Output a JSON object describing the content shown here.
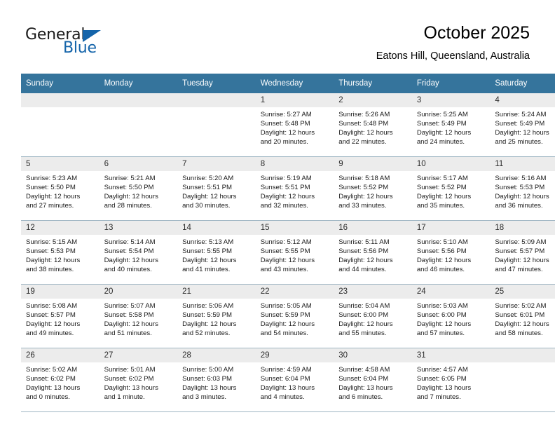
{
  "brand": {
    "name_part1": "General",
    "name_part2": "Blue",
    "logo_icon": "triangle-logo-icon",
    "accent_color": "#1464aa"
  },
  "header": {
    "month_title": "October 2025",
    "location": "Eatons Hill, Queensland, Australia"
  },
  "calendar": {
    "header_bg": "#35749c",
    "daynum_bg": "#ececec",
    "border_color": "#9fb6c4",
    "weekday_headers": [
      "Sunday",
      "Monday",
      "Tuesday",
      "Wednesday",
      "Thursday",
      "Friday",
      "Saturday"
    ],
    "labels": {
      "sunrise": "Sunrise:",
      "sunset": "Sunset:",
      "daylight": "Daylight:"
    },
    "weeks": [
      [
        {
          "day": "",
          "empty": true
        },
        {
          "day": "",
          "empty": true
        },
        {
          "day": "",
          "empty": true
        },
        {
          "day": "1",
          "sunrise": "Sunrise: 5:27 AM",
          "sunset": "Sunset: 5:48 PM",
          "daylight_line1": "Daylight: 12 hours",
          "daylight_line2": "and 20 minutes."
        },
        {
          "day": "2",
          "sunrise": "Sunrise: 5:26 AM",
          "sunset": "Sunset: 5:48 PM",
          "daylight_line1": "Daylight: 12 hours",
          "daylight_line2": "and 22 minutes."
        },
        {
          "day": "3",
          "sunrise": "Sunrise: 5:25 AM",
          "sunset": "Sunset: 5:49 PM",
          "daylight_line1": "Daylight: 12 hours",
          "daylight_line2": "and 24 minutes."
        },
        {
          "day": "4",
          "sunrise": "Sunrise: 5:24 AM",
          "sunset": "Sunset: 5:49 PM",
          "daylight_line1": "Daylight: 12 hours",
          "daylight_line2": "and 25 minutes."
        }
      ],
      [
        {
          "day": "5",
          "sunrise": "Sunrise: 5:23 AM",
          "sunset": "Sunset: 5:50 PM",
          "daylight_line1": "Daylight: 12 hours",
          "daylight_line2": "and 27 minutes."
        },
        {
          "day": "6",
          "sunrise": "Sunrise: 5:21 AM",
          "sunset": "Sunset: 5:50 PM",
          "daylight_line1": "Daylight: 12 hours",
          "daylight_line2": "and 28 minutes."
        },
        {
          "day": "7",
          "sunrise": "Sunrise: 5:20 AM",
          "sunset": "Sunset: 5:51 PM",
          "daylight_line1": "Daylight: 12 hours",
          "daylight_line2": "and 30 minutes."
        },
        {
          "day": "8",
          "sunrise": "Sunrise: 5:19 AM",
          "sunset": "Sunset: 5:51 PM",
          "daylight_line1": "Daylight: 12 hours",
          "daylight_line2": "and 32 minutes."
        },
        {
          "day": "9",
          "sunrise": "Sunrise: 5:18 AM",
          "sunset": "Sunset: 5:52 PM",
          "daylight_line1": "Daylight: 12 hours",
          "daylight_line2": "and 33 minutes."
        },
        {
          "day": "10",
          "sunrise": "Sunrise: 5:17 AM",
          "sunset": "Sunset: 5:52 PM",
          "daylight_line1": "Daylight: 12 hours",
          "daylight_line2": "and 35 minutes."
        },
        {
          "day": "11",
          "sunrise": "Sunrise: 5:16 AM",
          "sunset": "Sunset: 5:53 PM",
          "daylight_line1": "Daylight: 12 hours",
          "daylight_line2": "and 36 minutes."
        }
      ],
      [
        {
          "day": "12",
          "sunrise": "Sunrise: 5:15 AM",
          "sunset": "Sunset: 5:53 PM",
          "daylight_line1": "Daylight: 12 hours",
          "daylight_line2": "and 38 minutes."
        },
        {
          "day": "13",
          "sunrise": "Sunrise: 5:14 AM",
          "sunset": "Sunset: 5:54 PM",
          "daylight_line1": "Daylight: 12 hours",
          "daylight_line2": "and 40 minutes."
        },
        {
          "day": "14",
          "sunrise": "Sunrise: 5:13 AM",
          "sunset": "Sunset: 5:55 PM",
          "daylight_line1": "Daylight: 12 hours",
          "daylight_line2": "and 41 minutes."
        },
        {
          "day": "15",
          "sunrise": "Sunrise: 5:12 AM",
          "sunset": "Sunset: 5:55 PM",
          "daylight_line1": "Daylight: 12 hours",
          "daylight_line2": "and 43 minutes."
        },
        {
          "day": "16",
          "sunrise": "Sunrise: 5:11 AM",
          "sunset": "Sunset: 5:56 PM",
          "daylight_line1": "Daylight: 12 hours",
          "daylight_line2": "and 44 minutes."
        },
        {
          "day": "17",
          "sunrise": "Sunrise: 5:10 AM",
          "sunset": "Sunset: 5:56 PM",
          "daylight_line1": "Daylight: 12 hours",
          "daylight_line2": "and 46 minutes."
        },
        {
          "day": "18",
          "sunrise": "Sunrise: 5:09 AM",
          "sunset": "Sunset: 5:57 PM",
          "daylight_line1": "Daylight: 12 hours",
          "daylight_line2": "and 47 minutes."
        }
      ],
      [
        {
          "day": "19",
          "sunrise": "Sunrise: 5:08 AM",
          "sunset": "Sunset: 5:57 PM",
          "daylight_line1": "Daylight: 12 hours",
          "daylight_line2": "and 49 minutes."
        },
        {
          "day": "20",
          "sunrise": "Sunrise: 5:07 AM",
          "sunset": "Sunset: 5:58 PM",
          "daylight_line1": "Daylight: 12 hours",
          "daylight_line2": "and 51 minutes."
        },
        {
          "day": "21",
          "sunrise": "Sunrise: 5:06 AM",
          "sunset": "Sunset: 5:59 PM",
          "daylight_line1": "Daylight: 12 hours",
          "daylight_line2": "and 52 minutes."
        },
        {
          "day": "22",
          "sunrise": "Sunrise: 5:05 AM",
          "sunset": "Sunset: 5:59 PM",
          "daylight_line1": "Daylight: 12 hours",
          "daylight_line2": "and 54 minutes."
        },
        {
          "day": "23",
          "sunrise": "Sunrise: 5:04 AM",
          "sunset": "Sunset: 6:00 PM",
          "daylight_line1": "Daylight: 12 hours",
          "daylight_line2": "and 55 minutes."
        },
        {
          "day": "24",
          "sunrise": "Sunrise: 5:03 AM",
          "sunset": "Sunset: 6:00 PM",
          "daylight_line1": "Daylight: 12 hours",
          "daylight_line2": "and 57 minutes."
        },
        {
          "day": "25",
          "sunrise": "Sunrise: 5:02 AM",
          "sunset": "Sunset: 6:01 PM",
          "daylight_line1": "Daylight: 12 hours",
          "daylight_line2": "and 58 minutes."
        }
      ],
      [
        {
          "day": "26",
          "sunrise": "Sunrise: 5:02 AM",
          "sunset": "Sunset: 6:02 PM",
          "daylight_line1": "Daylight: 13 hours",
          "daylight_line2": "and 0 minutes."
        },
        {
          "day": "27",
          "sunrise": "Sunrise: 5:01 AM",
          "sunset": "Sunset: 6:02 PM",
          "daylight_line1": "Daylight: 13 hours",
          "daylight_line2": "and 1 minute."
        },
        {
          "day": "28",
          "sunrise": "Sunrise: 5:00 AM",
          "sunset": "Sunset: 6:03 PM",
          "daylight_line1": "Daylight: 13 hours",
          "daylight_line2": "and 3 minutes."
        },
        {
          "day": "29",
          "sunrise": "Sunrise: 4:59 AM",
          "sunset": "Sunset: 6:04 PM",
          "daylight_line1": "Daylight: 13 hours",
          "daylight_line2": "and 4 minutes."
        },
        {
          "day": "30",
          "sunrise": "Sunrise: 4:58 AM",
          "sunset": "Sunset: 6:04 PM",
          "daylight_line1": "Daylight: 13 hours",
          "daylight_line2": "and 6 minutes."
        },
        {
          "day": "31",
          "sunrise": "Sunrise: 4:57 AM",
          "sunset": "Sunset: 6:05 PM",
          "daylight_line1": "Daylight: 13 hours",
          "daylight_line2": "and 7 minutes."
        },
        {
          "day": "",
          "empty": true
        }
      ]
    ]
  }
}
